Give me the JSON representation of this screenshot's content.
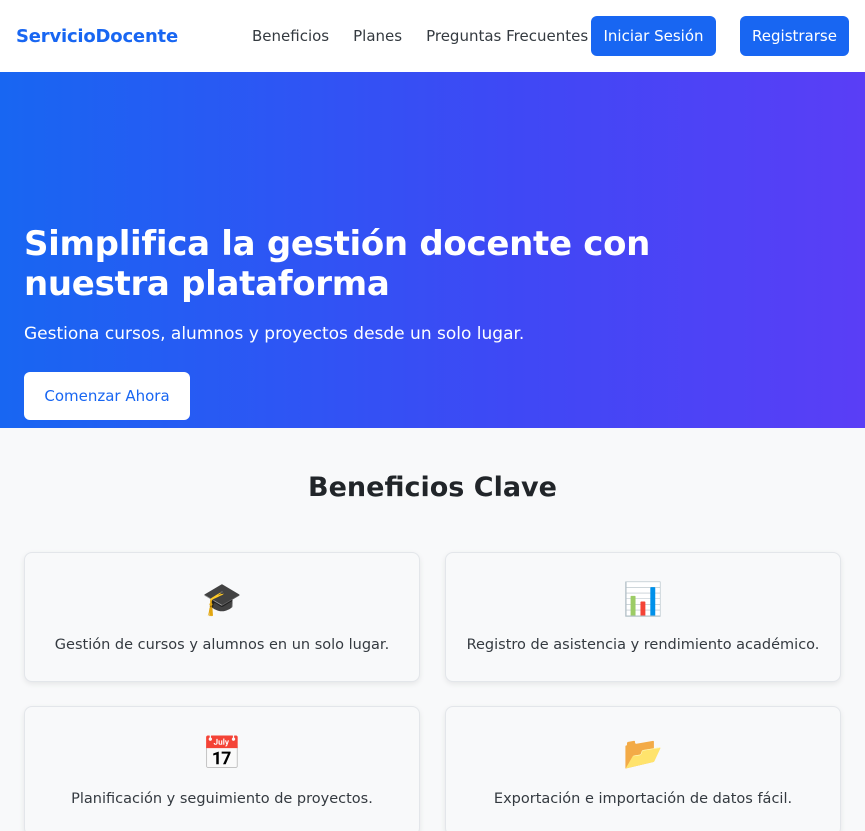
{
  "navbar": {
    "brand": "ServicioDocente",
    "links": [
      "Beneficios",
      "Planes",
      "Preguntas Frecuentes"
    ],
    "login_label": "Iniciar Sesión",
    "register_label": "Registrarse"
  },
  "hero": {
    "title": "Simplifica la gestión docente con nuestra plataforma",
    "subtitle": "Gestiona cursos, alumnos y proyectos desde un solo lugar.",
    "cta_label": "Comenzar Ahora"
  },
  "benefits": {
    "title": "Beneficios Clave",
    "items": [
      {
        "icon": "🎓",
        "icon_name": "graduation-cap-icon",
        "text": "Gestión de cursos y alumnos en un solo lugar."
      },
      {
        "icon": "📊",
        "icon_name": "bar-chart-icon",
        "text": "Registro de asistencia y rendimiento académico."
      },
      {
        "icon": "📅",
        "icon_name": "calendar-icon",
        "text": "Planificación y seguimiento de proyectos."
      },
      {
        "icon": "📂",
        "icon_name": "folder-icon",
        "text": "Exportación e importación de datos fácil."
      }
    ]
  },
  "colors": {
    "primary": "#1866f2",
    "gradient_end": "#5a3ef6",
    "background": "#f8f9fa"
  }
}
